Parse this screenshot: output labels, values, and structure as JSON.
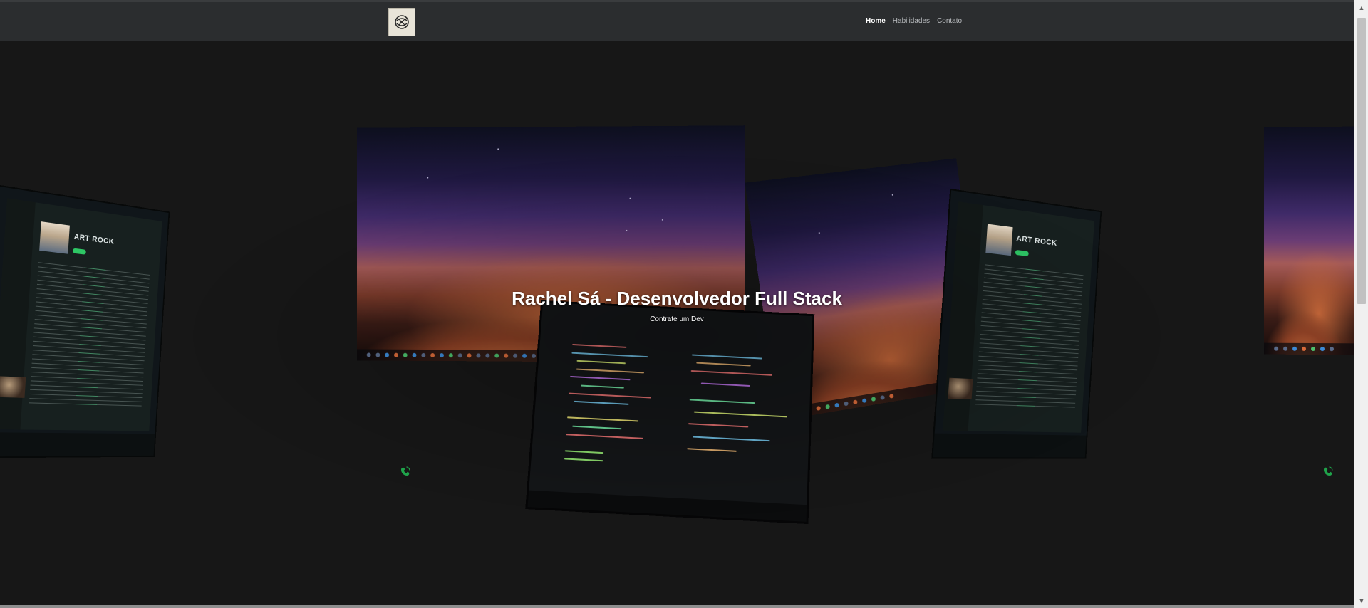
{
  "navbar": {
    "logo_icon": "brain-logo-icon",
    "links": [
      {
        "label": "Home",
        "active": true
      },
      {
        "label": "Habilidades",
        "active": false
      },
      {
        "label": "Contato",
        "active": false
      }
    ]
  },
  "hero": {
    "title": "Rachel Sá - Desenvolvedor Full Stack",
    "cta_label": "Contrate um Dev",
    "music_app_title": "ART ROCK",
    "contact_icon": "phone-icon",
    "contact_icon_color": "#1fa34a"
  },
  "colors": {
    "navbar_bg": "#2b2d2f",
    "page_bg": "#171717",
    "active_link": "#ffffff",
    "link": "#b9bcbf"
  }
}
